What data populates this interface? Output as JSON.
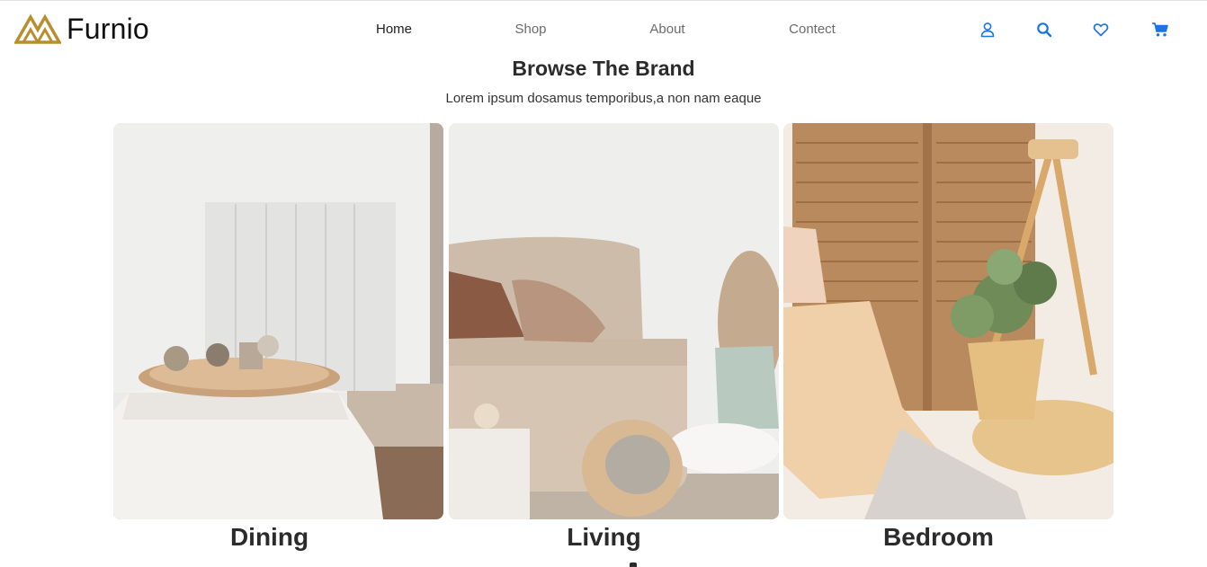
{
  "header": {
    "brand_name": "Furnio",
    "brand_color": "#B88E2F",
    "nav": [
      {
        "label": "Home",
        "active": true
      },
      {
        "label": "Shop",
        "active": false
      },
      {
        "label": "About",
        "active": false
      },
      {
        "label": "Contect",
        "active": false
      }
    ],
    "icons": [
      "user-icon",
      "search-icon",
      "heart-icon",
      "cart-icon"
    ],
    "icon_color": "#1A73E8"
  },
  "section": {
    "title": "Browse The Brand",
    "subtitle": "Lorem ipsum dosamus temporibus,a non nam eaque"
  },
  "categories": [
    {
      "label": "Dining"
    },
    {
      "label": "Living"
    },
    {
      "label": "Bedroom"
    }
  ]
}
